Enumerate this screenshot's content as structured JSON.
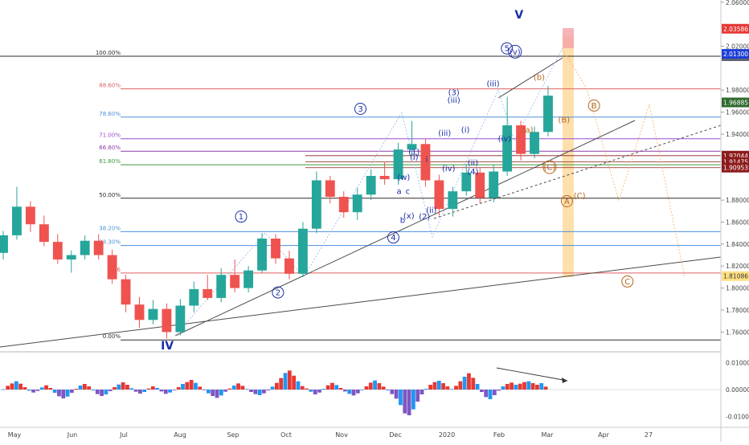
{
  "chart_data": {
    "type": "candlestick",
    "title": "",
    "xlabel": "",
    "ylabel": "",
    "ylim": [
      1.742,
      2.062
    ],
    "oscillator_ylim": [
      -0.0135,
      0.0135
    ],
    "grid": false,
    "x_ticks": [
      "May",
      "Jun",
      "Jul",
      "Aug",
      "Sep",
      "Oct",
      "Nov",
      "Dec",
      "2020",
      "Feb",
      "Mar",
      "Apr",
      "27"
    ],
    "price_axis_ticks": [
      "2.06000",
      "2.02000",
      "1.98000",
      "1.96000",
      "1.94000",
      "1.88000",
      "1.86000",
      "1.84000",
      "1.82000",
      "1.80000",
      "1.78000",
      "1.76000"
    ],
    "oscillator_axis_ticks": [
      "0.01000",
      "0.00000",
      "-0.01000"
    ],
    "price_badges": [
      {
        "label": "2.03586",
        "color": "#e53935",
        "text_color": "#ffffff"
      },
      {
        "label": "2.01086",
        "color": "#5f6570",
        "text_color": "#ffffff"
      },
      {
        "label": "2.01300",
        "color": "#1e3fd6",
        "text_color": "#ffffff"
      },
      {
        "label": "1.96885",
        "color": "#2e6b2e",
        "text_color": "#ffffff"
      },
      {
        "label": "1.92044",
        "color": "#8c1b1b",
        "text_color": "#ffffff"
      },
      {
        "label": "1.91475",
        "color": "#8c1b1b",
        "text_color": "#ffffff"
      },
      {
        "label": "1.90953",
        "color": "#8c1b1b",
        "text_color": "#ffffff"
      },
      {
        "label": "1.81086",
        "color": "#ffe082",
        "text_color": "#333333"
      }
    ],
    "fib_levels": [
      {
        "label": "100.00%",
        "value": 2.01086,
        "color": "#2b2b2b"
      },
      {
        "label": "88.60%",
        "value": 1.9812,
        "color": "#e06060"
      },
      {
        "label": "78.60%",
        "value": 1.9555,
        "color": "#4a90d9"
      },
      {
        "label": "71.00%",
        "value": 1.9358,
        "color": "#9c4dcc"
      },
      {
        "label": "66.60%",
        "value": 1.9245,
        "color": "#8a3fa8"
      },
      {
        "label": "61.80%",
        "value": 1.9121,
        "color": "#3a9a3a"
      },
      {
        "label": "50.00%",
        "value": 1.8817,
        "color": "#2b2b2b"
      },
      {
        "label": "38.20%",
        "value": 1.8513,
        "color": "#4a90d9"
      },
      {
        "label": "33.30%",
        "value": 1.8387,
        "color": "#4a90d9"
      },
      {
        "label": "23.6",
        "value": 1.8137,
        "color": "#e06060"
      },
      {
        "label": "0.00%",
        "value": 1.7528,
        "color": "#2b2b2b"
      }
    ],
    "candles": [
      {
        "period": "May",
        "open": 1.832,
        "high": 1.852,
        "low": 1.826,
        "close": 1.848
      },
      {
        "period": "May",
        "open": 1.848,
        "high": 1.892,
        "low": 1.844,
        "close": 1.874
      },
      {
        "period": "May",
        "open": 1.874,
        "high": 1.879,
        "low": 1.851,
        "close": 1.858
      },
      {
        "period": "May",
        "open": 1.858,
        "high": 1.866,
        "low": 1.838,
        "close": 1.842
      },
      {
        "period": "Jun",
        "open": 1.842,
        "high": 1.849,
        "low": 1.822,
        "close": 1.826
      },
      {
        "period": "Jun",
        "open": 1.826,
        "high": 1.834,
        "low": 1.814,
        "close": 1.83
      },
      {
        "period": "Jun",
        "open": 1.83,
        "high": 1.848,
        "low": 1.826,
        "close": 1.843
      },
      {
        "period": "Jun",
        "open": 1.843,
        "high": 1.849,
        "low": 1.826,
        "close": 1.83
      },
      {
        "period": "Jul",
        "open": 1.83,
        "high": 1.835,
        "low": 1.804,
        "close": 1.808
      },
      {
        "period": "Jul",
        "open": 1.808,
        "high": 1.812,
        "low": 1.778,
        "close": 1.785
      },
      {
        "period": "Jul",
        "open": 1.785,
        "high": 1.792,
        "low": 1.764,
        "close": 1.771
      },
      {
        "period": "Jul",
        "open": 1.771,
        "high": 1.789,
        "low": 1.767,
        "close": 1.781
      },
      {
        "period": "Aug",
        "open": 1.781,
        "high": 1.786,
        "low": 1.754,
        "close": 1.76
      },
      {
        "period": "Aug",
        "open": 1.76,
        "high": 1.79,
        "low": 1.757,
        "close": 1.784
      },
      {
        "period": "Aug",
        "open": 1.784,
        "high": 1.806,
        "low": 1.778,
        "close": 1.799
      },
      {
        "period": "Aug",
        "open": 1.799,
        "high": 1.812,
        "low": 1.789,
        "close": 1.791
      },
      {
        "period": "Sep",
        "open": 1.791,
        "high": 1.818,
        "low": 1.787,
        "close": 1.812
      },
      {
        "period": "Sep",
        "open": 1.812,
        "high": 1.826,
        "low": 1.796,
        "close": 1.8
      },
      {
        "period": "Sep",
        "open": 1.8,
        "high": 1.82,
        "low": 1.796,
        "close": 1.816
      },
      {
        "period": "Sep",
        "open": 1.816,
        "high": 1.85,
        "low": 1.814,
        "close": 1.845
      },
      {
        "period": "Sep",
        "open": 1.845,
        "high": 1.849,
        "low": 1.822,
        "close": 1.827
      },
      {
        "period": "Oct",
        "open": 1.827,
        "high": 1.834,
        "low": 1.808,
        "close": 1.813
      },
      {
        "period": "Oct",
        "open": 1.813,
        "high": 1.86,
        "low": 1.81,
        "close": 1.854
      },
      {
        "period": "Oct",
        "open": 1.854,
        "high": 1.906,
        "low": 1.85,
        "close": 1.898
      },
      {
        "period": "Oct",
        "open": 1.898,
        "high": 1.902,
        "low": 1.877,
        "close": 1.883
      },
      {
        "period": "Nov",
        "open": 1.883,
        "high": 1.888,
        "low": 1.864,
        "close": 1.869
      },
      {
        "period": "Nov",
        "open": 1.869,
        "high": 1.891,
        "low": 1.862,
        "close": 1.885
      },
      {
        "period": "Nov",
        "open": 1.885,
        "high": 1.908,
        "low": 1.88,
        "close": 1.902
      },
      {
        "period": "Nov",
        "open": 1.902,
        "high": 1.915,
        "low": 1.894,
        "close": 1.899
      },
      {
        "period": "Dec",
        "open": 1.899,
        "high": 1.932,
        "low": 1.894,
        "close": 1.926
      },
      {
        "period": "Dec",
        "open": 1.926,
        "high": 1.952,
        "low": 1.92,
        "close": 1.931
      },
      {
        "period": "Dec",
        "open": 1.931,
        "high": 1.936,
        "low": 1.892,
        "close": 1.898
      },
      {
        "period": "Dec",
        "open": 1.898,
        "high": 1.903,
        "low": 1.866,
        "close": 1.872
      },
      {
        "period": "2020",
        "open": 1.872,
        "high": 1.892,
        "low": 1.865,
        "close": 1.888
      },
      {
        "period": "2020",
        "open": 1.888,
        "high": 1.912,
        "low": 1.884,
        "close": 1.905
      },
      {
        "period": "2020",
        "open": 1.905,
        "high": 1.909,
        "low": 1.877,
        "close": 1.882
      },
      {
        "period": "2020",
        "open": 1.882,
        "high": 1.912,
        "low": 1.878,
        "close": 1.906
      },
      {
        "period": "Feb",
        "open": 1.906,
        "high": 1.974,
        "low": 1.902,
        "close": 1.948
      },
      {
        "period": "Feb",
        "open": 1.948,
        "high": 1.952,
        "low": 1.916,
        "close": 1.922
      },
      {
        "period": "Feb",
        "open": 1.922,
        "high": 1.947,
        "low": 1.918,
        "close": 1.942
      },
      {
        "period": "Feb",
        "open": 1.942,
        "high": 1.984,
        "low": 1.938,
        "close": 1.975
      }
    ],
    "oscillator": [
      0.0001,
      0.0014,
      0.0023,
      0.0031,
      0.0022,
      0.0009,
      -0.0004,
      -0.0011,
      -0.0005,
      0.0008,
      0.0016,
      0.0006,
      -0.0012,
      -0.0025,
      -0.0033,
      -0.0026,
      -0.0012,
      0.0003,
      0.0015,
      0.0021,
      0.0012,
      -0.0003,
      -0.0017,
      -0.0024,
      -0.0018,
      -0.0006,
      0.0009,
      0.0019,
      0.0027,
      0.0018,
      0.0005,
      -0.0008,
      -0.0015,
      -0.0009,
      0.0004,
      0.0012,
      0.0006,
      -0.0007,
      -0.0016,
      -0.0011,
      -0.0002,
      0.0009,
      0.0021,
      0.0028,
      0.0036,
      0.0025,
      0.0011,
      -0.0002,
      -0.0014,
      -0.0024,
      -0.0031,
      -0.0022,
      -0.0008,
      0.0004,
      0.0015,
      0.0023,
      0.0014,
      0.0002,
      -0.0009,
      -0.0017,
      -0.0021,
      -0.0014,
      -0.0003,
      0.0011,
      0.0025,
      0.0043,
      0.0062,
      0.0071,
      0.0052,
      0.0031,
      0.0013,
      0.0004,
      -0.0008,
      -0.0018,
      -0.0011,
      0.0003,
      0.0016,
      0.0025,
      0.0017,
      0.0006,
      -0.0007,
      -0.0016,
      -0.0022,
      -0.0014,
      -0.0002,
      0.0012,
      0.0026,
      0.0034,
      0.0024,
      0.0011,
      -0.0003,
      -0.0017,
      -0.0034,
      -0.0058,
      -0.0089,
      -0.0096,
      -0.0074,
      -0.0045,
      -0.0018,
      0.0003,
      0.0018,
      0.0028,
      0.0033,
      0.0024,
      0.0012,
      0.0002,
      0.0014,
      0.0031,
      0.0048,
      0.0061,
      0.0044,
      0.0021,
      -0.0009,
      -0.0028,
      -0.0036,
      -0.0021,
      -0.0004,
      0.0012,
      0.0021,
      0.0026,
      0.0018,
      0.0022,
      0.0028,
      0.0031,
      0.0024,
      0.0018,
      0.0024,
      0.0011
    ],
    "wave_labels": [
      {
        "text": "V",
        "color": "#1a2fa8",
        "circled": false,
        "date_frac": 0.9,
        "price": 2.049
      },
      {
        "text": "5",
        "color": "#1a2fa8",
        "circled": true,
        "date_frac": 0.879,
        "price": 2.018
      },
      {
        "text": "(v)",
        "color": "#1a2fa8",
        "circled": true,
        "date_frac": 0.893,
        "price": 2.015
      },
      {
        "text": "3",
        "color": "#1a2fa8",
        "circled": true,
        "date_frac": 0.625,
        "price": 1.963
      },
      {
        "text": "(3)",
        "color": "#1a2fa8",
        "circled": false,
        "date_frac": 0.787,
        "price": 1.978
      },
      {
        "text": "(iii)",
        "color": "#1a2fa8",
        "circled": false,
        "date_frac": 0.787,
        "price": 1.971
      },
      {
        "text": "(iii)",
        "color": "#1a2fa8",
        "circled": false,
        "date_frac": 0.855,
        "price": 1.986
      },
      {
        "text": "(i)",
        "color": "#1a2fa8",
        "circled": false,
        "date_frac": 0.807,
        "price": 1.944
      },
      {
        "text": "(iii)",
        "color": "#1a2fa8",
        "circled": false,
        "date_frac": 0.771,
        "price": 1.941
      },
      {
        "text": "(iv)",
        "color": "#1a2fa8",
        "circled": false,
        "date_frac": 0.875,
        "price": 1.936
      },
      {
        "text": "(1)",
        "color": "#1a2fa8",
        "circled": false,
        "date_frac": 0.718,
        "price": 1.924
      },
      {
        "text": "(i)",
        "color": "#1a2fa8",
        "circled": false,
        "date_frac": 0.718,
        "price": 1.919
      },
      {
        "text": "i",
        "color": "#1a2fa8",
        "circled": false,
        "date_frac": 0.74,
        "price": 1.917
      },
      {
        "text": "(ii)",
        "color": "#1a2fa8",
        "circled": false,
        "date_frac": 0.82,
        "price": 1.914
      },
      {
        "text": "(iv)",
        "color": "#1a2fa8",
        "circled": false,
        "date_frac": 0.778,
        "price": 1.909
      },
      {
        "text": "(4)",
        "color": "#1a2fa8",
        "circled": false,
        "date_frac": 0.82,
        "price": 1.906
      },
      {
        "text": "(w)",
        "color": "#1a2fa8",
        "circled": false,
        "date_frac": 0.7,
        "price": 1.901
      },
      {
        "text": "a",
        "color": "#1a2fa8",
        "circled": false,
        "date_frac": 0.692,
        "price": 1.888
      },
      {
        "text": "c",
        "color": "#1a2fa8",
        "circled": false,
        "date_frac": 0.707,
        "price": 1.888
      },
      {
        "text": "(ii)",
        "color": "#1a2fa8",
        "circled": false,
        "date_frac": 0.748,
        "price": 1.871
      },
      {
        "text": "(x)",
        "color": "#1a2fa8",
        "circled": false,
        "date_frac": 0.709,
        "price": 1.866
      },
      {
        "text": "b",
        "color": "#1a2fa8",
        "circled": false,
        "date_frac": 0.698,
        "price": 1.862
      },
      {
        "text": "(2)",
        "color": "#1a2fa8",
        "circled": false,
        "date_frac": 0.736,
        "price": 1.865
      },
      {
        "text": "4",
        "color": "#1a2fa8",
        "circled": true,
        "date_frac": 0.682,
        "price": 1.846
      },
      {
        "text": "1",
        "color": "#1a2fa8",
        "circled": true,
        "date_frac": 0.418,
        "price": 1.865
      },
      {
        "text": "2",
        "color": "#1a2fa8",
        "circled": true,
        "date_frac": 0.482,
        "price": 1.796
      },
      {
        "text": "IV",
        "color": "#1a2fa8",
        "circled": false,
        "date_frac": 0.29,
        "price": 1.748
      },
      {
        "text": "(b)",
        "color": "#b5651d",
        "circled": false,
        "date_frac": 0.935,
        "price": 1.992
      },
      {
        "text": "(a)",
        "color": "#b5651d",
        "circled": false,
        "date_frac": 0.915,
        "price": 1.944
      },
      {
        "text": "(B)",
        "color": "#b5651d",
        "circled": false,
        "date_frac": 0.978,
        "price": 1.953
      },
      {
        "text": "B",
        "color": "#b5651d",
        "circled": true,
        "date_frac": 1.03,
        "price": 1.966
      },
      {
        "text": "(C)",
        "color": "#b5651d",
        "circled": true,
        "date_frac": 0.953,
        "price": 1.91
      },
      {
        "text": "A",
        "color": "#b5651d",
        "circled": true,
        "date_frac": 0.983,
        "price": 1.879
      },
      {
        "text": "(C)",
        "color": "#b5651d",
        "circled": false,
        "date_frac": 1.005,
        "price": 1.884
      },
      {
        "text": "C",
        "color": "#b5651d",
        "circled": true,
        "date_frac": 1.088,
        "price": 1.806
      }
    ]
  }
}
